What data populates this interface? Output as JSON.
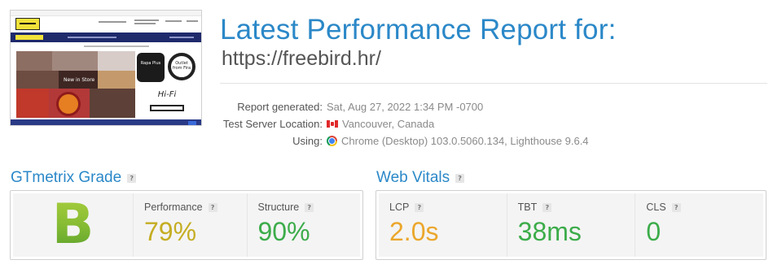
{
  "header": {
    "title": "Latest Performance Report for:",
    "url": "https://freebird.hr/"
  },
  "thumbnail": {
    "hero_caption": "New in Store",
    "store_sign_1": "Rapa Plus",
    "store_sign_2": "Outlet from Fira",
    "store_sign_3": "Hi-Fi"
  },
  "report_meta": {
    "generated_label": "Report generated:",
    "generated_value": "Sat, Aug 27, 2022 1:34 PM -0700",
    "location_label": "Test Server Location:",
    "location_flag": "canada-flag-icon",
    "location_value": "Vancouver, Canada",
    "using_label": "Using:",
    "using_icon": "chrome-icon",
    "using_value": "Chrome (Desktop) 103.0.5060.134, Lighthouse 9.6.4"
  },
  "gtmetrix_grade": {
    "heading": "GTmetrix Grade",
    "help": "?",
    "grade": "B",
    "grade_color": "#8bc034",
    "metrics": [
      {
        "label": "Performance",
        "help": "?",
        "value": "79%",
        "color": "#c5ad22"
      },
      {
        "label": "Structure",
        "help": "?",
        "value": "90%",
        "color": "#3cac4a"
      }
    ]
  },
  "web_vitals": {
    "heading": "Web Vitals",
    "help": "?",
    "metrics": [
      {
        "label": "LCP",
        "help": "?",
        "value": "2.0s",
        "color": "#eba72c"
      },
      {
        "label": "TBT",
        "help": "?",
        "value": "38ms",
        "color": "#3cac4a"
      },
      {
        "label": "CLS",
        "help": "?",
        "value": "0",
        "color": "#3cac4a"
      }
    ]
  }
}
